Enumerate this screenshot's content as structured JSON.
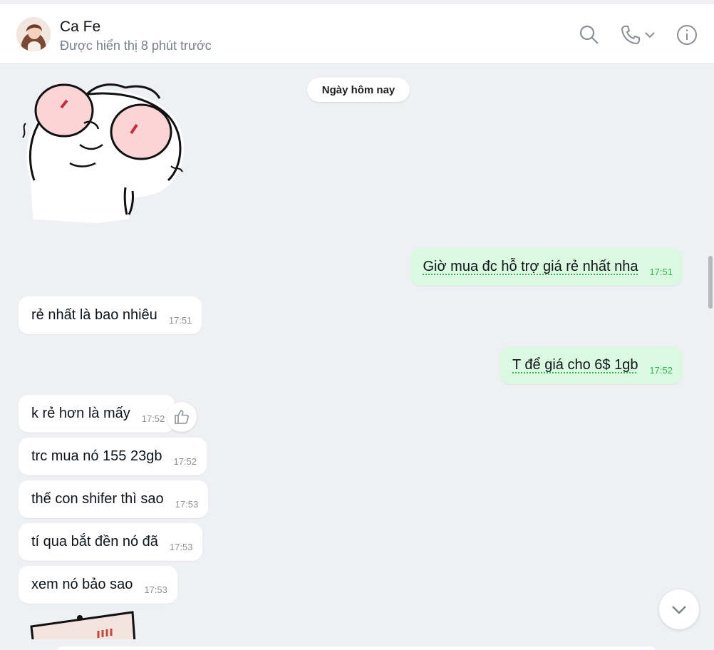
{
  "header": {
    "name": "Ca Fe",
    "status": "Được hiển thị 8 phút trước",
    "icons": [
      "search-icon",
      "phone-icon",
      "chevron-down-icon",
      "info-icon"
    ]
  },
  "chat": {
    "date_label": "Ngày hôm nay",
    "messages": [
      {
        "dir": "out",
        "text": "Giờ mua đc hỗ trợ giá rẻ nhất nha",
        "time": "17:51"
      },
      {
        "dir": "in",
        "text": "rẻ nhất là bao nhiêu",
        "time": "17:51"
      },
      {
        "dir": "out",
        "text": "T để giá cho 6$ 1gb",
        "time": "17:52"
      },
      {
        "dir": "in",
        "text": "k rẻ hơn là mấy",
        "time": "17:52"
      },
      {
        "dir": "in",
        "text": "trc mua nó 155 23gb",
        "time": "17:52"
      },
      {
        "dir": "in",
        "text": "thế con shifer thì sao",
        "time": "17:53"
      },
      {
        "dir": "in",
        "text": "tí qua bắt đền nó đã",
        "time": "17:53"
      },
      {
        "dir": "in",
        "text": "xem nó bảo sao",
        "time": "17:53"
      }
    ],
    "stickers": [
      "crying-bunny-sticker",
      "bunny-sign-sticker"
    ],
    "icons": [
      "like-icon",
      "scroll-down-icon"
    ]
  },
  "colors": {
    "background": "#eef0f4",
    "incoming_bubble": "#ffffff",
    "outgoing_bubble": "#dbf9e0",
    "outgoing_time": "#2fb84f",
    "icon_gray": "#8a8f96"
  }
}
